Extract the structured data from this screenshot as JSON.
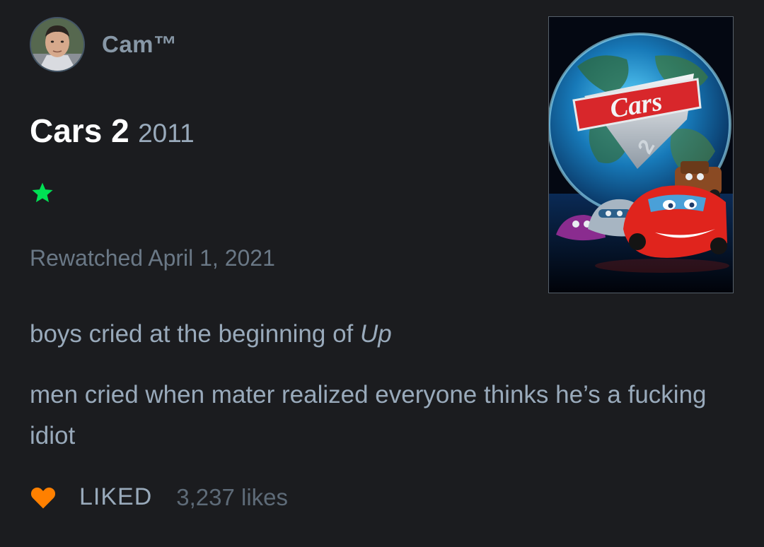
{
  "user": {
    "name": "Cam™"
  },
  "film": {
    "title": "Cars 2",
    "year": "2011",
    "poster_logo_text": "Cars",
    "poster_logo_number": "2"
  },
  "rating": {
    "stars": 1,
    "max_stars": 5,
    "color": "#00e054",
    "icon": "star-icon"
  },
  "watch": {
    "text": "Rewatched April 1, 2021"
  },
  "review": {
    "line1_prefix": "boys cried at the beginning of ",
    "line1_italic": "Up",
    "line2": "men cried when mater realized everyone thinks he’s a fucking idiot"
  },
  "likes": {
    "icon": "heart-icon",
    "heart_color": "#ff8000",
    "label": "LIKED",
    "count": "3,237 likes"
  }
}
